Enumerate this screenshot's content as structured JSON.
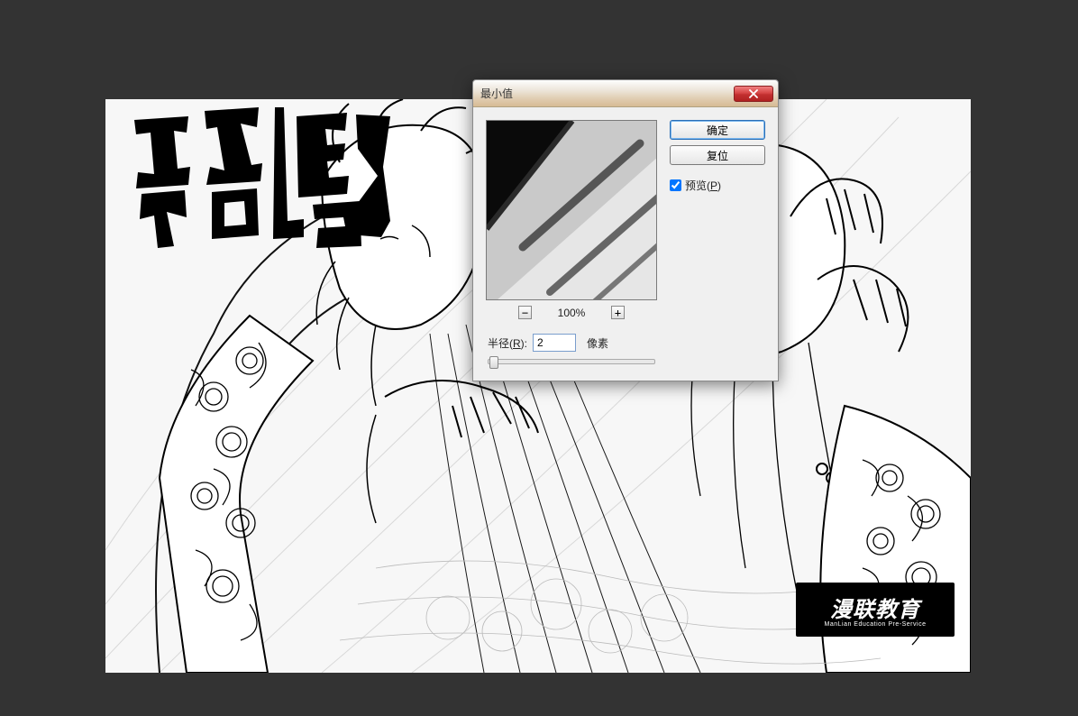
{
  "canvas": {
    "title_calligraphy": "春秋封神",
    "watermark_main": "漫联教育",
    "watermark_sub": "ManLian Education Pre-Service"
  },
  "dialog": {
    "title": "最小值",
    "ok_label": "确定",
    "reset_label": "复位",
    "preview_label_pre": "预览(",
    "preview_label_key": "P",
    "preview_label_post": ")",
    "preview_checked": true,
    "zoom": {
      "minus": "−",
      "plus": "+",
      "level": "100%"
    },
    "radius": {
      "label_pre": "半径(",
      "label_key": "R",
      "label_post": "):",
      "value": "2",
      "unit": "像素"
    }
  }
}
